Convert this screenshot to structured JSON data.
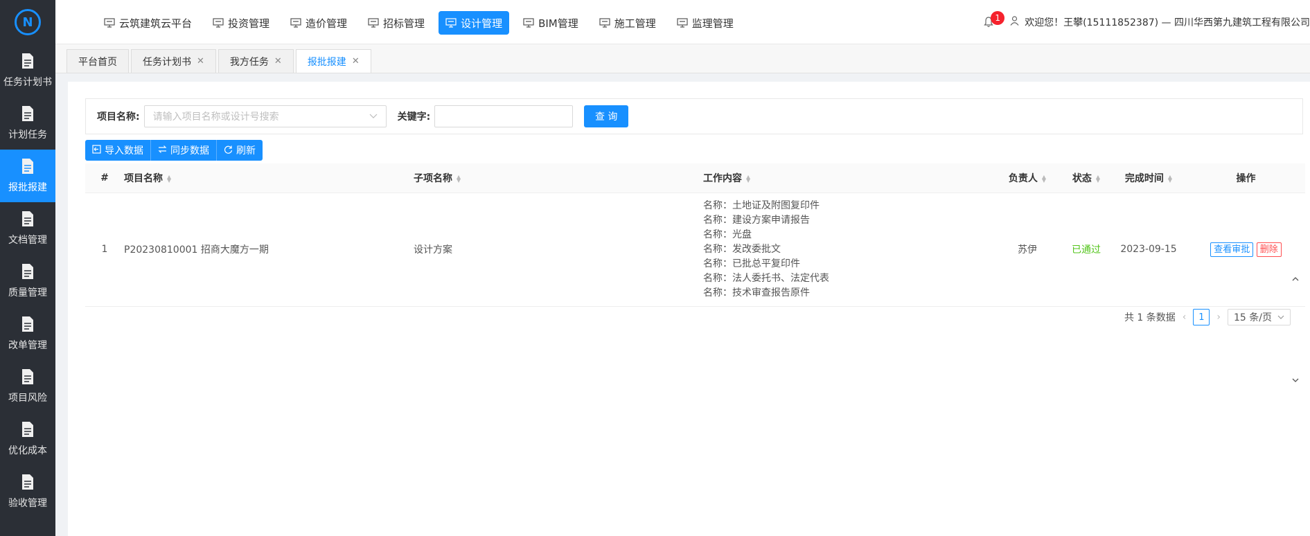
{
  "sidebar": {
    "logo_text": "N",
    "items": [
      {
        "label": "任务计划书",
        "active": false
      },
      {
        "label": "计划任务",
        "active": false
      },
      {
        "label": "报批报建",
        "active": true
      },
      {
        "label": "文档管理",
        "active": false
      },
      {
        "label": "质量管理",
        "active": false
      },
      {
        "label": "改单管理",
        "active": false
      },
      {
        "label": "项目风险",
        "active": false
      },
      {
        "label": "优化成本",
        "active": false
      },
      {
        "label": "验收管理",
        "active": false
      }
    ]
  },
  "topnav": {
    "items": [
      "云筑建筑云平台",
      "投资管理",
      "造价管理",
      "招标管理",
      "设计管理",
      "BIM管理",
      "施工管理",
      "监理管理"
    ],
    "active_index": 4
  },
  "user": {
    "notification_count": "1",
    "welcome": "欢迎您！王攀(15111852387) — 四川华西第九建筑工程有限公司"
  },
  "tabs": [
    {
      "label": "平台首页",
      "closable": false
    },
    {
      "label": "任务计划书",
      "closable": true
    },
    {
      "label": "我方任务",
      "closable": true
    },
    {
      "label": "报批报建",
      "closable": true
    }
  ],
  "search": {
    "project_label": "项目名称:",
    "project_placeholder": "请输入项目名称或设计号搜索",
    "keyword_label": "关键字:",
    "keyword_value": "",
    "query_button": "查 询"
  },
  "toolbar": {
    "import": "导入数据",
    "sync": "同步数据",
    "refresh": "刷新"
  },
  "table": {
    "headers": {
      "index": "#",
      "project": "项目名称",
      "subitem": "子项名称",
      "work": "工作内容",
      "owner": "负责人",
      "status": "状态",
      "done_time": "完成时间",
      "ops": "操作"
    },
    "rows": [
      {
        "index": "1",
        "project": "P20230810001 招商大魔方一期",
        "subitem": "设计方案",
        "work": [
          "名称：土地证及附图复印件",
          "名称：建设方案申请报告",
          "名称：光盘",
          "名称：发改委批文",
          "名称：已批总平复印件",
          "名称：法人委托书、法定代表",
          "名称：技术审查报告原件"
        ],
        "owner": "苏伊",
        "status": "已通过",
        "done_time": "2023-09-15",
        "view_btn": "查看审批",
        "delete_btn": "删除"
      }
    ]
  },
  "pagination": {
    "total": "共 1 条数据",
    "current": "1",
    "page_size": "15 条/页"
  },
  "colors": {
    "primary": "#1890ff",
    "sidebar_bg": "#2b2f36",
    "success": "#52c41a",
    "danger": "#ff4d4f"
  }
}
